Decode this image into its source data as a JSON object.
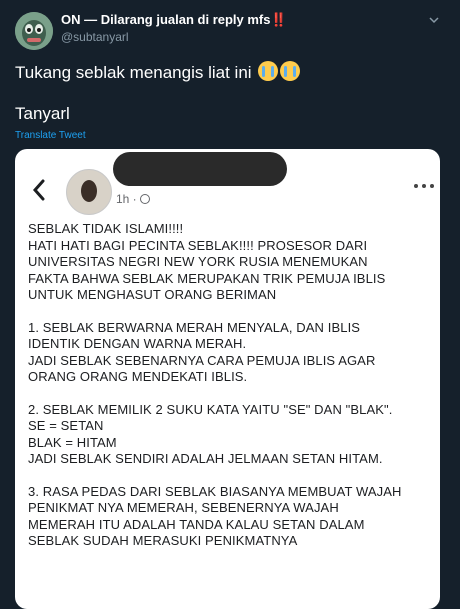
{
  "tweet": {
    "author": {
      "display_name": "ON — Dilarang jualan di reply mfs",
      "display_name_suffix": "‼️",
      "handle": "@subtanyarl"
    },
    "text": "Tukang seblak menangis liat ini",
    "emoji": "😭😭",
    "text2": "Tanyarl",
    "translate_label": "Translate Tweet"
  },
  "embedded_post": {
    "time": "1h ·",
    "lines": [
      "SEBLAK TIDAK ISLAMI!!!!",
      "HATI HATI BAGI PECINTA SEBLAK!!!! PROSESOR DARI",
      "UNIVERSITAS NEGRI NEW YORK RUSIA MENEMUKAN",
      "FAKTA BAHWA SEBLAK MERUPAKAN TRIK PEMUJA IBLIS",
      "UNTUK MENGHASUT ORANG BERIMAN",
      "",
      "1. SEBLAK BERWARNA MERAH MENYALA, DAN IBLIS",
      "IDENTIK DENGAN WARNA MERAH.",
      "JADI SEBLAK SEBENARNYA CARA PEMUJA IBLIS AGAR",
      "ORANG ORANG MENDEKATI IBLIS.",
      "",
      "2. SEBLAK MEMILIK 2 SUKU KATA YAITU \"SE\" DAN \"BLAK\".",
      "SE = SETAN",
      "BLAK = HITAM",
      "JADI SEBLAK SENDIRI ADALAH JELMAAN SETAN HITAM.",
      "",
      "3. RASA PEDAS DARI SEBLAK BIASANYA MEMBUAT WAJAH",
      "PENIKMAT NYA MEMERAH, SEBENERNYA WAJAH",
      "MEMERAH ITU ADALAH TANDA KALAU SETAN DALAM",
      "SEBLAK SUDAH MERASUKI PENIKMATNYA"
    ]
  },
  "colors": {
    "background": "#15202b",
    "link": "#1da1f2",
    "muted": "#8899a6"
  },
  "icons": {
    "caret": "chevron-down-icon",
    "back": "back-arrow-icon",
    "more": "more-dots-icon",
    "globe": "globe-icon"
  }
}
